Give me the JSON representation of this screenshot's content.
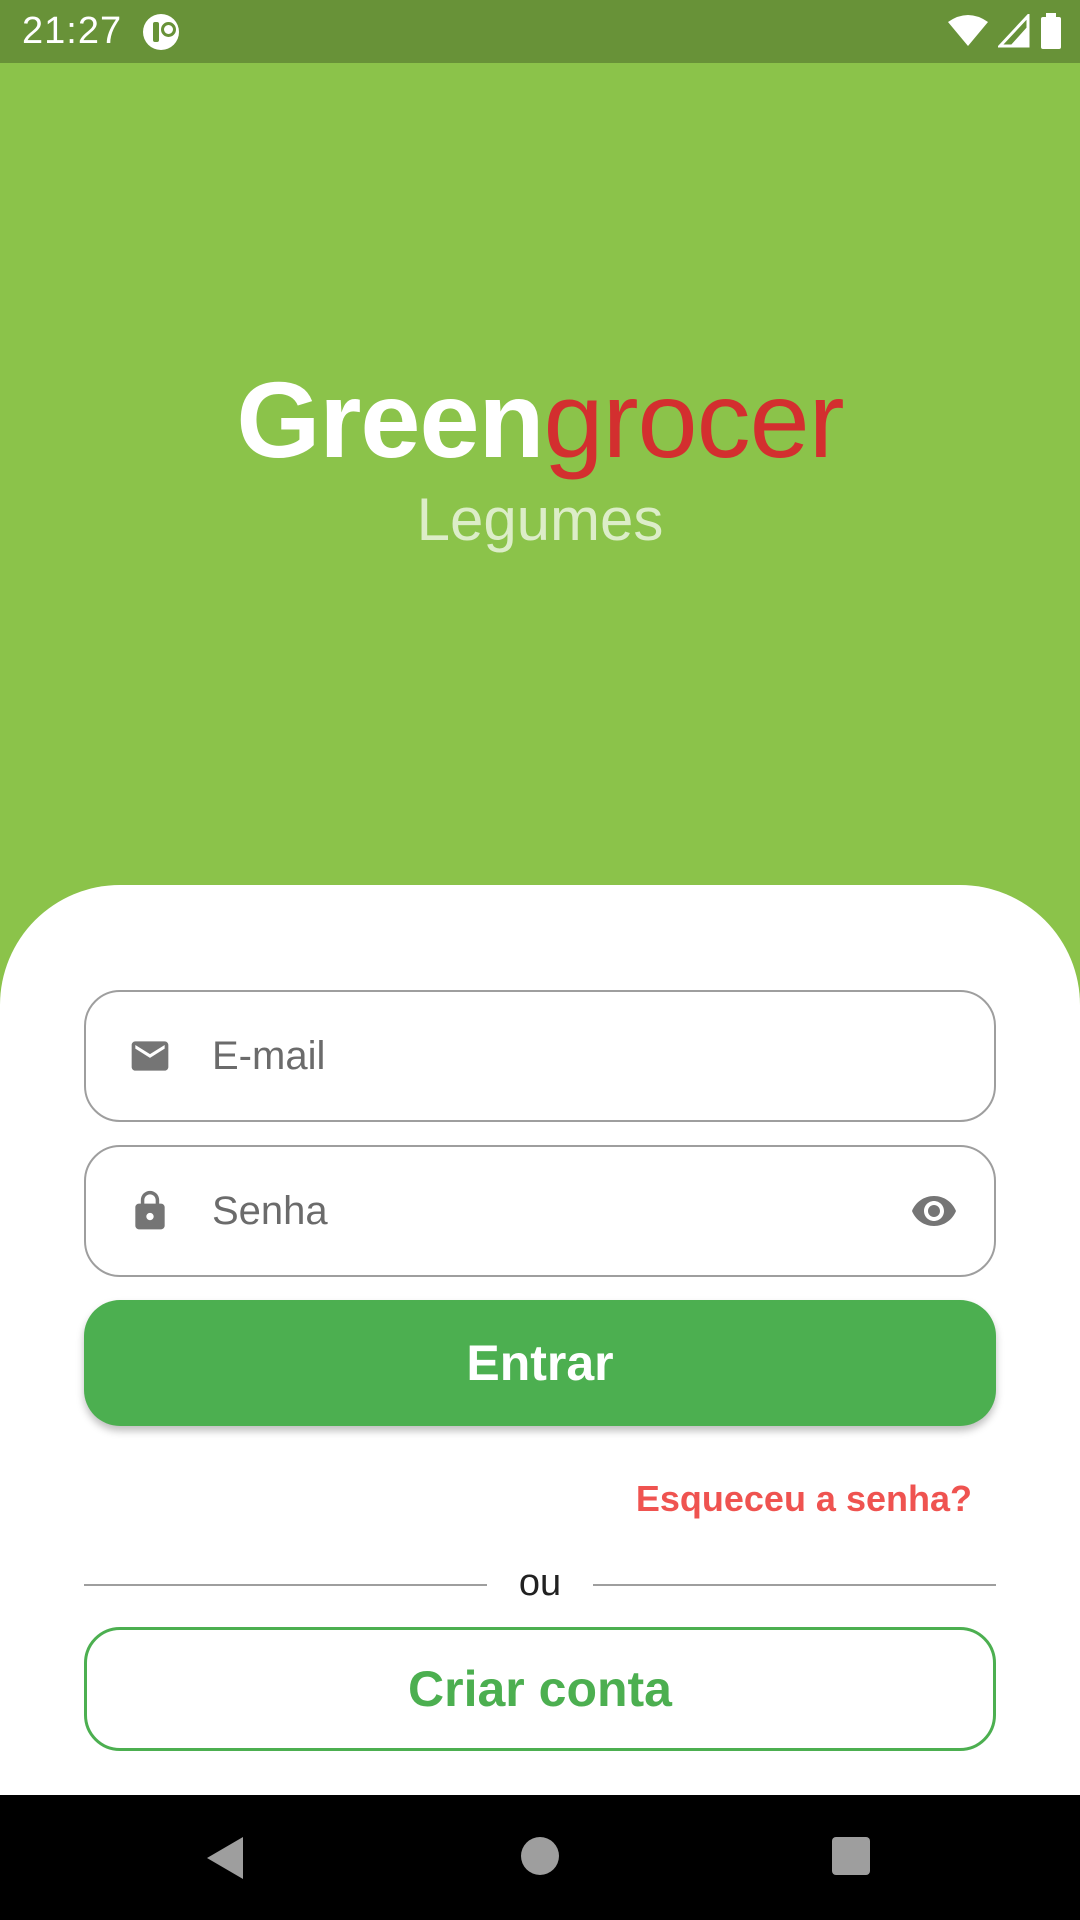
{
  "status_bar": {
    "time": "21:27",
    "icons": [
      "app-notification-icon",
      "wifi-icon",
      "cellular-signal-icon",
      "battery-icon"
    ]
  },
  "brand": {
    "title_part1": "Green",
    "title_part2": "grocer",
    "subtitle": "Legumes"
  },
  "login_form": {
    "email": {
      "placeholder": "E-mail",
      "value": "",
      "icon": "email-icon"
    },
    "password": {
      "placeholder": "Senha",
      "value": "",
      "icon": "lock-icon",
      "toggle_icon": "eye-icon"
    },
    "submit_label": "Entrar",
    "forgot_label": "Esqueceu a senha?",
    "divider_label": "ou",
    "create_account_label": "Criar conta"
  },
  "nav_bar": {
    "icons": [
      "back-icon",
      "home-icon",
      "recents-icon"
    ]
  },
  "colors": {
    "background": "#8bc34a",
    "status_bar": "#689238",
    "accent_red": "#d32f2f",
    "primary_green": "#4caf50",
    "link_red": "#ef5350"
  }
}
